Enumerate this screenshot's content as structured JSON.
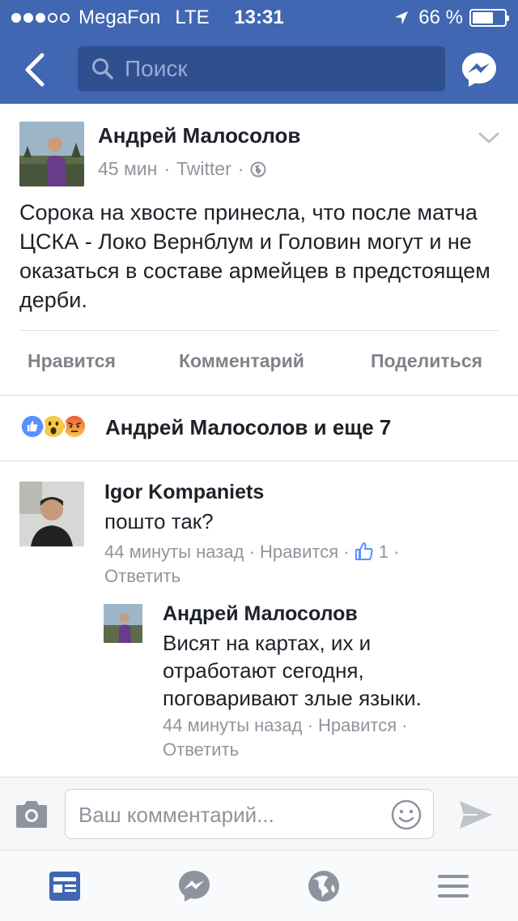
{
  "status_bar": {
    "carrier": "MegaFon",
    "network": "LTE",
    "time": "13:31",
    "battery_text": "66 %",
    "battery_level": 0.66
  },
  "header": {
    "search_placeholder": "Поиск",
    "accent": "#4267b2"
  },
  "post": {
    "author": "Андрей Малосолов",
    "time": "45 мин",
    "source": "Twitter",
    "text": "Сорока на хвосте принесла, что после матча  ЦСКА - Локо Вернблум и Головин могут и не оказаться в составе армейцев в предстоящем дерби.",
    "actions": {
      "like": "Нравится",
      "comment": "Комментарий",
      "share": "Поделиться"
    },
    "reactions_text": "Андрей Малосолов и еще 7",
    "reaction_icons": [
      "like-icon",
      "wow-icon",
      "angry-icon"
    ]
  },
  "comments": [
    {
      "author": "Igor Kompaniets",
      "text": "пошто так?",
      "time": "44 минуты назад",
      "like": "Нравится",
      "likes": "1",
      "reply": "Ответить"
    },
    {
      "author": "Андрей Малосолов",
      "text": "Висят на картах, их и отработают сегодня, поговаривают злые языки.",
      "time": "44 минуты назад",
      "like": "Нравится",
      "reply": "Ответить"
    }
  ],
  "composer": {
    "placeholder": "Ваш комментарий..."
  },
  "tabs": [
    "news-feed-icon",
    "messenger-icon",
    "globe-icon",
    "menu-icon"
  ]
}
